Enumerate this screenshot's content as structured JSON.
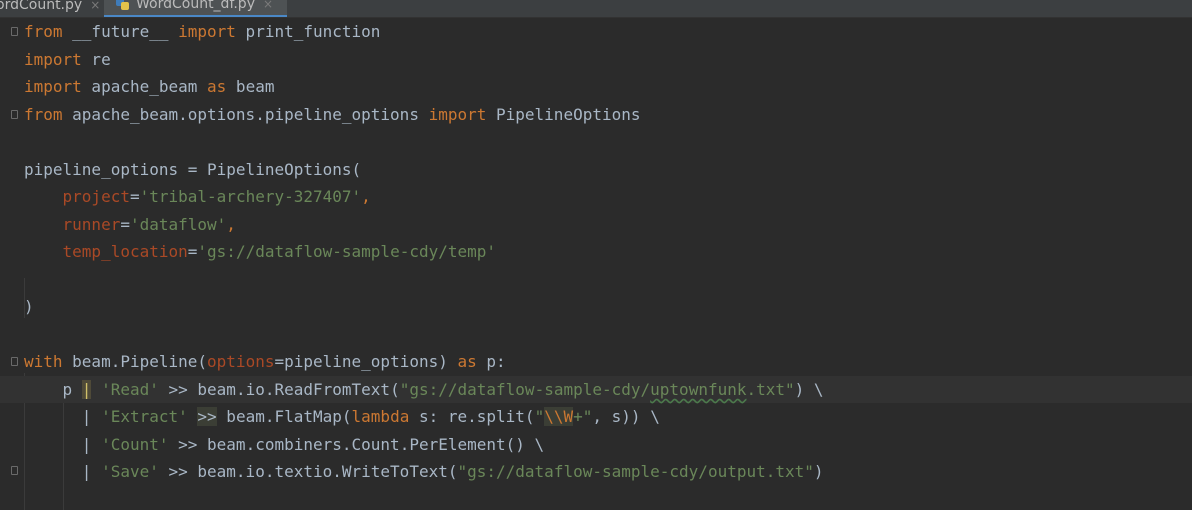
{
  "tabs": [
    {
      "label": "WordCount.py",
      "close": "×",
      "active": false
    },
    {
      "label": "WordCount_df.py",
      "close": "×",
      "active": true,
      "icon": "python-file-icon"
    }
  ],
  "code": {
    "l1": {
      "from": "from",
      "mod": " __future__ ",
      "import": "import",
      "name": " print_function"
    },
    "l2": {
      "import": "import",
      "name": " re"
    },
    "l3": {
      "import": "import",
      "name": " apache_beam ",
      "as": "as",
      "alias": " beam"
    },
    "l4": {
      "from": "from",
      "mod": " apache_beam.options.pipeline_options ",
      "import": "import",
      "name": " PipelineOptions"
    },
    "l6": {
      "text": "pipeline_options = PipelineOptions("
    },
    "l7": {
      "indent": "    ",
      "kw": "project",
      "eq": "=",
      "str": "'tribal-archery-327407'",
      "comma": ","
    },
    "l8": {
      "indent": "    ",
      "kw": "runner",
      "eq": "=",
      "str": "'dataflow'",
      "comma": ","
    },
    "l9": {
      "indent": "    ",
      "kw": "temp_location",
      "eq": "=",
      "str": "'gs://dataflow-sample-cdy/temp'"
    },
    "l11": {
      "text": ")"
    },
    "l13": {
      "with": "with",
      "a": " beam.Pipeline(",
      "kwarg": "options",
      "b": "=pipeline_options) ",
      "as": "as",
      "c": " p:"
    },
    "l14": {
      "indent": "    p ",
      "pipe": "|",
      "sp": " ",
      "str": "'Read'",
      "a": " >> beam.io.ReadFromText(",
      "s1": "\"gs://dataflow-sample-cdy/",
      "typo": "uptownfunk",
      "s2": ".txt\"",
      "b": ") \\"
    },
    "l15": {
      "indent": "      | ",
      "str": "'Extract'",
      "sp": " ",
      "op": ">>",
      "a": " beam.FlatMap(",
      "lambda": "lambda",
      "b": " s: re.split(",
      "q1": "\"",
      "esc": "\\\\W",
      "plus": "+",
      "q2": "\"",
      "c": ", s)) \\"
    },
    "l16": {
      "indent": "      | ",
      "str": "'Count'",
      "a": " >> beam.combiners.Count.PerElement() \\"
    },
    "l17": {
      "indent": "      | ",
      "str": "'Save'",
      "a": " >> beam.io.textio.WriteToText(",
      "s": "\"gs://dataflow-sample-cdy/output.txt\"",
      "b": ")"
    }
  }
}
